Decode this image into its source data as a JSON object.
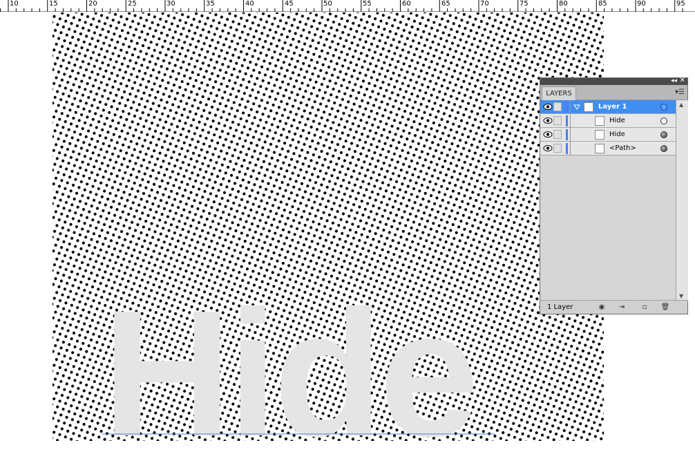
{
  "ruler": {
    "labels": [
      "10",
      "15",
      "20",
      "25",
      "30",
      "35",
      "40",
      "45",
      "50",
      "55",
      "60",
      "65",
      "70",
      "75",
      "80",
      "85",
      "90",
      "95"
    ]
  },
  "artboard": {
    "text": "Hide",
    "text_color": "#e5e5e5",
    "dot_color": "#000000",
    "guide_color": "#4a7fd4"
  },
  "layers_panel": {
    "tab_label": "LAYERS",
    "collapse_icon": "double-chevron-icon",
    "close_icon": "close-icon",
    "menu_icon": "panel-menu-icon",
    "rows": [
      {
        "name": "Layer 1",
        "selected": true,
        "target": "selected"
      },
      {
        "name": "Hide",
        "selected": false,
        "target": "empty"
      },
      {
        "name": "Hide",
        "selected": false,
        "target": "filled"
      },
      {
        "name": "<Path>",
        "selected": false,
        "target": "filled"
      }
    ],
    "footer": {
      "layer_count": "1 Layer",
      "icons": [
        "make-clipping-mask-icon",
        "create-sublayer-icon",
        "create-new-layer-icon",
        "delete-layer-icon"
      ]
    },
    "selection_color": "#3f8ff0",
    "layer_color": "#4f7df5"
  }
}
